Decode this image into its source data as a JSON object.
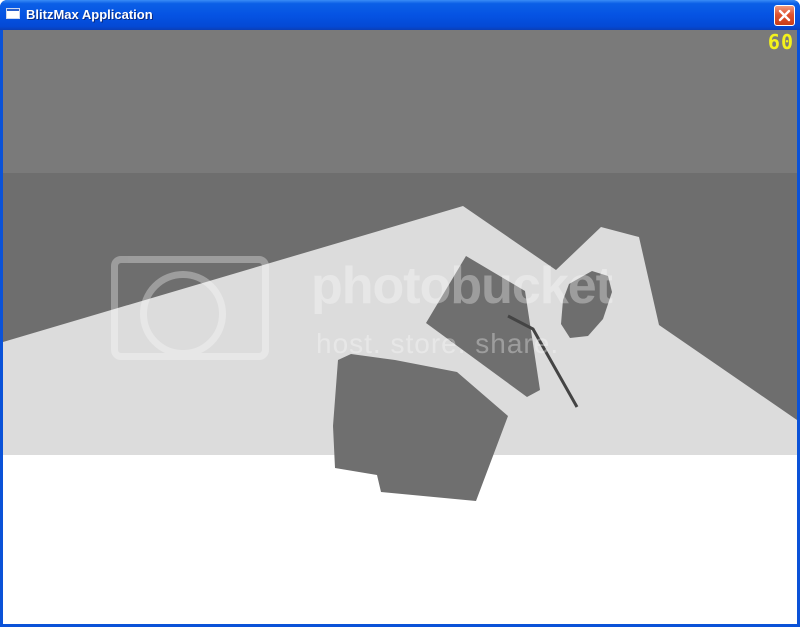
{
  "window": {
    "title": "BlitzMax Application",
    "icon": "app-window-icon",
    "close_icon": "close-icon"
  },
  "hud": {
    "fps": "60",
    "fps_color": "#f4f21c"
  },
  "watermark": {
    "name": "photobucket",
    "tagline": "host. store. share."
  },
  "colors": {
    "sky_upper": "#7a7a7a",
    "sky_lower": "#6e6e6e",
    "mid_ground": "#dcdcdc",
    "foreground": "#ffffff",
    "shape_fill": "#6f6f6f",
    "titlebar": "#0553e3",
    "close_button": "#e0532f"
  }
}
